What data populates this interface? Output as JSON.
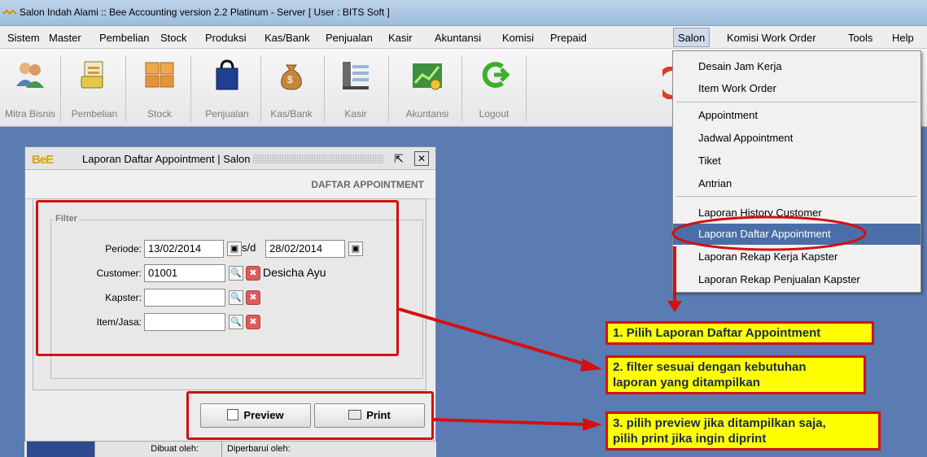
{
  "window_title": "Salon Indah Alami :: Bee Accounting version 2.2 Platinum - Server  [ User : BITS Soft ]",
  "menu": [
    "Sistem",
    "Master",
    "Pembelian",
    "Stock",
    "Produksi",
    "Kas/Bank",
    "Penjualan",
    "Kasir",
    "Akuntansi",
    "Komisi",
    "Prepaid",
    "Salon",
    "Komisi Work Order",
    "Tools",
    "Help"
  ],
  "active_menu": "Salon",
  "toolbar": [
    "Mitra Bisnis",
    "Pembelian",
    "Stock",
    "Penjualan",
    "Kas/Bank",
    "Kasir",
    "Akuntansi",
    "Logout"
  ],
  "salon_menu": {
    "group1": [
      "Desain Jam Kerja",
      "Item Work Order"
    ],
    "group2": [
      "Appointment",
      "Jadwal Appointment",
      "Tiket",
      "Antrian"
    ],
    "group3": [
      "Laporan History Customer",
      "Laporan Daftar Appointment",
      "Laporan Rekap Kerja Kapster",
      "Laporan Rekap Penjualan Kapster"
    ],
    "highlighted": "Laporan Daftar Appointment"
  },
  "report_window": {
    "logo": "BeE",
    "title": "Laporan Daftar Appointment | Salon",
    "header": "DAFTAR APPOINTMENT",
    "filter_legend": "Filter",
    "periode_label": "Periode:",
    "periode_from": "13/02/2014",
    "periode_to_label": "s/d",
    "periode_to": "28/02/2014",
    "customer_label": "Customer:",
    "customer_code": "01001",
    "customer_name": "Desicha Ayu",
    "kapster_label": "Kapster:",
    "kapster_value": "",
    "item_label": "Item/Jasa:",
    "item_value": "",
    "preview_label": "Preview",
    "print_label": "Print",
    "status_created": "Dibuat oleh:",
    "status_updated": "Diperbarui oleh:"
  },
  "callouts": {
    "step1": "1. Pilih Laporan Daftar Appointment",
    "step2_line1": "2. filter sesuai dengan kebutuhan",
    "step2_line2": "laporan yang ditampilkan",
    "step3_line1": "3. pilih preview jika ditampilkan saja,",
    "step3_line2": "pilih print jika ingin diprint"
  },
  "colors": {
    "annotation_red": "#d41010",
    "callout_yellow": "#ffff00",
    "desktop_blue": "#5b7bb3",
    "menu_highlight": "#4a6fa8"
  }
}
